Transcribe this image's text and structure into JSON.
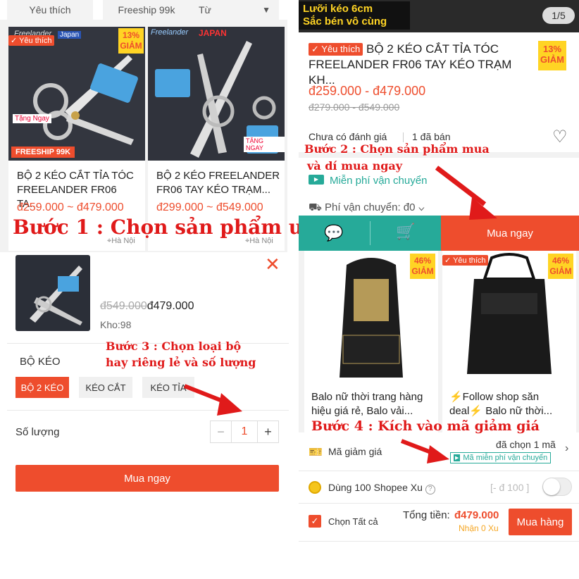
{
  "left": {
    "filters": [
      "Yêu thích",
      "Freeship 99k",
      "Từ"
    ],
    "products": [
      {
        "title": "BỘ 2 KÉO CẮT TỈA TÓC FREELANDER FR06 TA...",
        "price": "đ259.000 ~ đ479.000",
        "discount": "13%",
        "discount_label": "GIẢM",
        "fav": "Yêu thích",
        "location": "Hà Nội",
        "img_brand": "Freelander",
        "img_tag": "Japan",
        "img_promo": "FREESHIP 99K",
        "img_gift": "Tặng Ngay"
      },
      {
        "title": "BỘ 2 KÉO FREELANDER FR06 TAY KÉO TRẠM...",
        "price": "đ299.000 ~ đ549.000",
        "location": "Hà Nội",
        "img_brand": "Freelander",
        "img_tag": "JAPAN",
        "img_gift": "TẶNG NGAY"
      }
    ],
    "step1": "Bước 1 : Chọn sản phẩm ưng ý",
    "popup": {
      "old_price": "đ549.000",
      "price": "đ479.000",
      "stock": "Kho:98"
    },
    "step3_line1": "Bước 3 : Chọn loại bộ",
    "step3_line2": "hay riêng lẻ và số lượng",
    "variant_label": "BỘ KÉO",
    "variants": [
      "BỘ 2 KÉO",
      "KÉO CẮT",
      "KÉO TỈA"
    ],
    "qty_label": "Số lượng",
    "qty_value": "1",
    "qty_minus": "−",
    "qty_plus": "+",
    "buy_now": "Mua ngay"
  },
  "right": {
    "banner": "Lưỡi kéo 6cm",
    "banner2": "Sắc bén vô cùng",
    "page_indicator": "1/5",
    "fav": "Yêu thích",
    "title": "BỘ 2 KÉO CẮT TỈA TÓC FREELANDER FR06 TAY KÉO TRẠM KH...",
    "discount": "13%",
    "discount_label": "GIẢM",
    "price": "đ259.000 - đ479.000",
    "old_price": "đ279.000 - đ549.000",
    "rating": "Chưa có đánh giá",
    "sold": "1 đã bán",
    "step2_line1": "Bước 2 : Chọn sản phẩm mua",
    "step2_line2": "và dí mua ngay",
    "freeship": "Miễn phí vận chuyển",
    "shipping": "Phí vận chuyển: đ0",
    "buy_now": "Mua ngay",
    "bags": [
      {
        "title": "Balo nữ thời trang hàng hiệu giá rẻ, Balo vải...",
        "discount": "46%",
        "discount_label": "GIẢM"
      },
      {
        "title": "⚡Follow shop săn deal⚡ Balo nữ thời...",
        "discount": "46%",
        "discount_label": "GIẢM",
        "fav": "Yêu thích"
      }
    ],
    "step4": "Bước 4 : Kích vào mã giảm giá",
    "voucher_label": "Mã giảm giá",
    "voucher_selected": "đã chọn 1 mã",
    "voucher_tag": "Mã miễn phí vận chuyển",
    "xu_label": "Dùng 100 Shopee Xu",
    "xu_value": "[- đ 100 ]",
    "select_all": "Chọn Tất cả",
    "total_label": "Tổng tiền:",
    "total": "đ479.000",
    "xu_earn": "Nhận 0 Xu",
    "checkout": "Mua hàng"
  },
  "colors": {
    "accent": "#ee4d2d",
    "teal": "#26aa99",
    "badge": "#ffd424",
    "caption": "#e01a1a"
  }
}
